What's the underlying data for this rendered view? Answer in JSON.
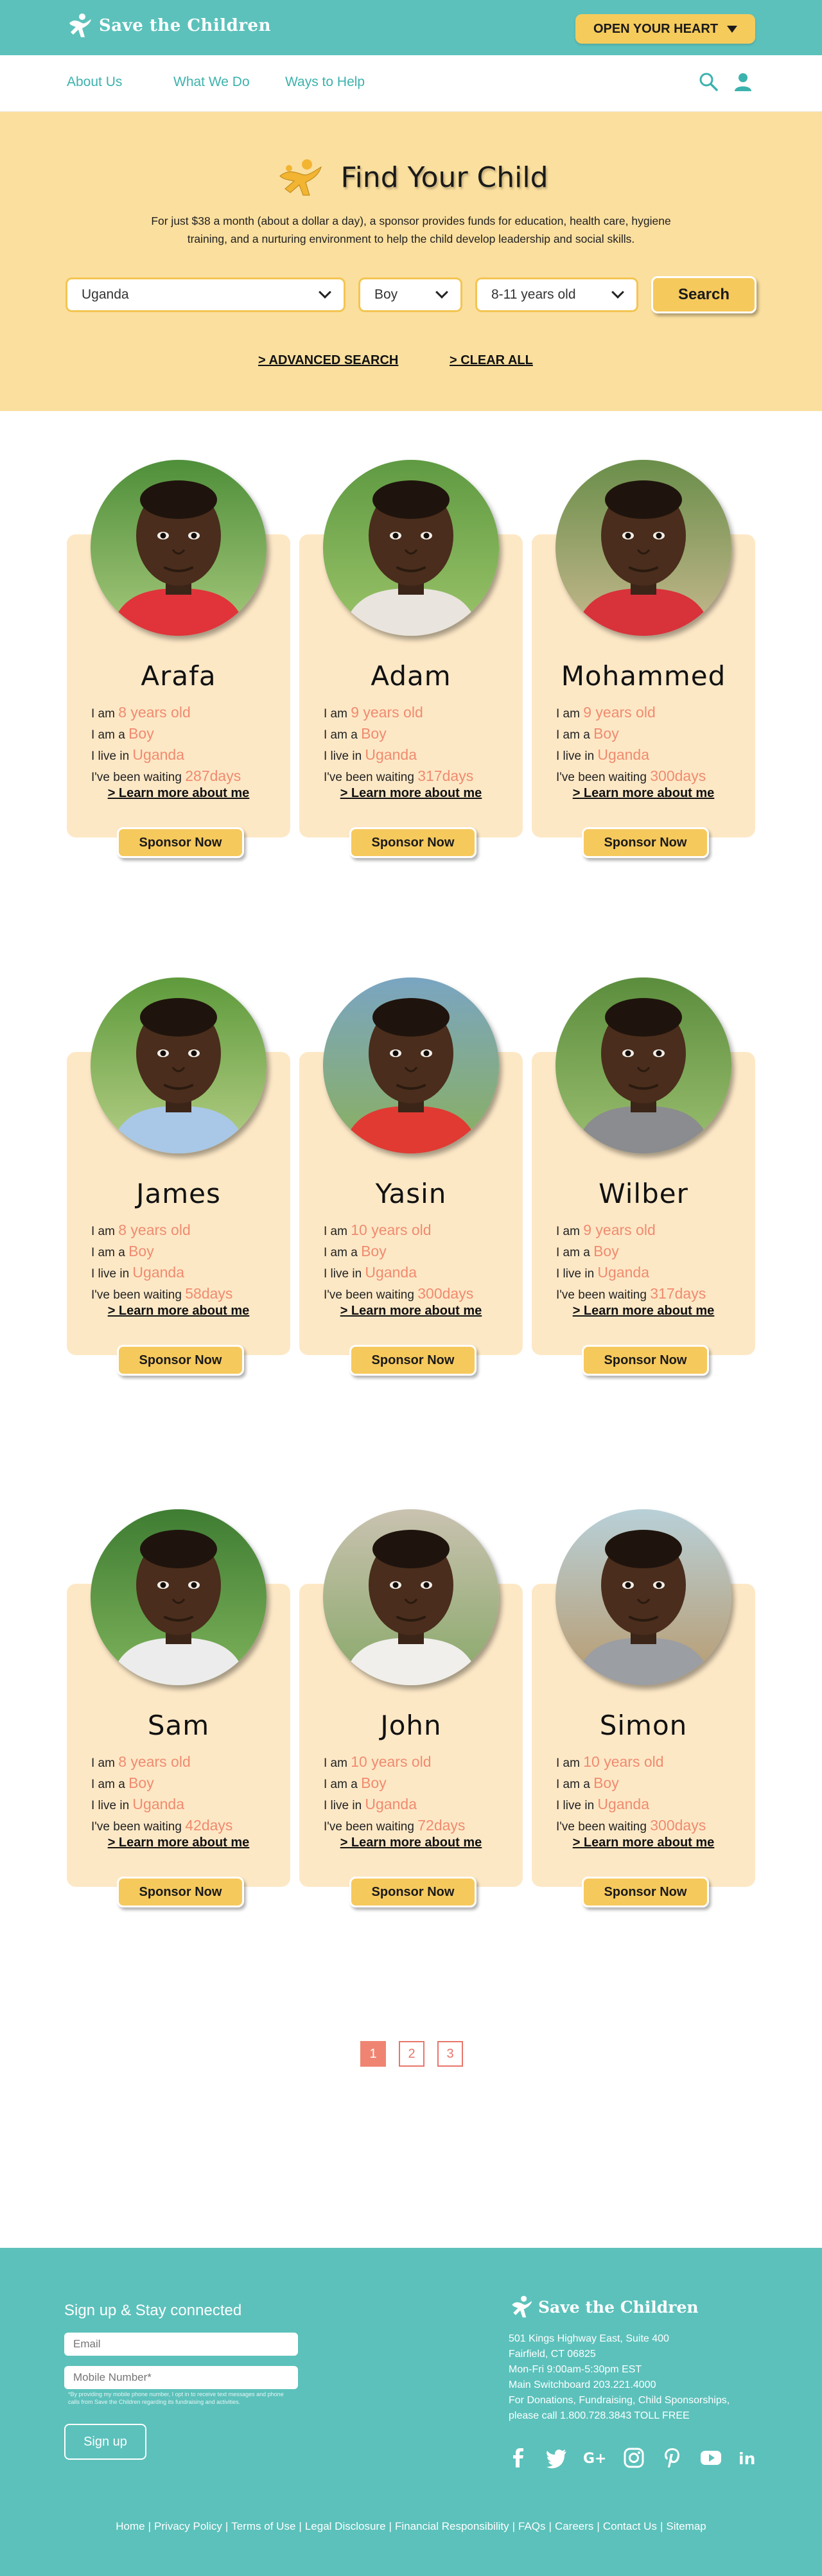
{
  "header": {
    "brand": "Save the Children",
    "cta_label": "OPEN YOUR HEART",
    "nav": [
      {
        "label": "About Us"
      },
      {
        "label": "What We Do"
      },
      {
        "label": "Ways to Help"
      }
    ],
    "icons": [
      "search-icon",
      "user-icon"
    ],
    "colors": {
      "teal": "#5cc1bb",
      "gold": "#f5cb5c",
      "hero": "#fbdf9e",
      "card": "#fde8c6",
      "coral": "#f08b6f"
    }
  },
  "hero": {
    "title": "Find Your Child",
    "description": "For just $38 a month (about a dollar a day), a sponsor provides funds for education, health care, hygiene training, and a nurturing environment to help the child develop leadership and social skills.",
    "country": "Uganda",
    "gender": "Boy",
    "age": "8-11 years old",
    "search_label": "Search",
    "advanced_label": "> ADVANCED SEARCH",
    "clear_label": "> CLEAR ALL"
  },
  "children": [
    {
      "name": "Arafa",
      "age": "8 years old",
      "gender": "Boy",
      "country": "Uganda",
      "days": "287days",
      "shirt": "#e0343a",
      "bgtop": "#4f8f3a",
      "bgbot": "#a7c97c"
    },
    {
      "name": "Adam",
      "age": "9 years old",
      "gender": "Boy",
      "country": "Uganda",
      "days": "317days",
      "shirt": "#e9e4de",
      "bgtop": "#5f9a42",
      "bgbot": "#9cc46a"
    },
    {
      "name": "Mohammed",
      "age": "9 years old",
      "gender": "Boy",
      "country": "Uganda",
      "days": "300days",
      "shirt": "#d8323b",
      "bgtop": "#6a8e4a",
      "bgbot": "#c8b98f"
    },
    {
      "name": "James",
      "age": "8 years old",
      "gender": "Boy",
      "country": "Uganda",
      "days": "58days",
      "shirt": "#a9c7e6",
      "bgtop": "#5e9a3c",
      "bgbot": "#b6cf86"
    },
    {
      "name": "Yasin",
      "age": "10 years old",
      "gender": "Boy",
      "country": "Uganda",
      "days": "300days",
      "shirt": "#e13a33",
      "bgtop": "#7aa5c2",
      "bgbot": "#8bb05c"
    },
    {
      "name": "Wilber",
      "age": "9 years old",
      "gender": "Boy",
      "country": "Uganda",
      "days": "317days",
      "shirt": "#8b8c8f",
      "bgtop": "#5b8d3d",
      "bgbot": "#9cbf70"
    },
    {
      "name": "Sam",
      "age": "8 years old",
      "gender": "Boy",
      "country": "Uganda",
      "days": "42days",
      "shirt": "#ececec",
      "bgtop": "#3f7d33",
      "bgbot": "#7fb35b"
    },
    {
      "name": "John",
      "age": "10 years old",
      "gender": "Boy",
      "country": "Uganda",
      "days": "72days",
      "shirt": "#f0efec",
      "bgtop": "#c9c2b0",
      "bgbot": "#88a868"
    },
    {
      "name": "Simon",
      "age": "10 years old",
      "gender": "Boy",
      "country": "Uganda",
      "days": "300days",
      "shirt": "#9b9ea3",
      "bgtop": "#b8d0d8",
      "bgbot": "#b89a6d"
    }
  ],
  "card_labels": {
    "i_am": "I am",
    "i_am_a": "I am a",
    "i_live_in": "I live in",
    "waiting": "I've been waiting",
    "learn": "> Learn more about me",
    "sponsor": "Sponsor Now"
  },
  "pagination": {
    "pages": [
      "1",
      "2",
      "3"
    ],
    "current": "1"
  },
  "footer": {
    "signup_title": "Sign up & Stay connected",
    "email_placeholder": "Email",
    "mobile_placeholder": "Mobile Number*",
    "fine_print": "*By providing my mobile phone number, I opt in to receive text messages and phone calls from Save the Children regarding its fundraising and activities.",
    "signup_label": "Sign up",
    "brand": "Save the Children",
    "address": [
      "501 Kings Highway East, Suite 400",
      "Fairfield, CT 06825",
      "Mon-Fri 9:00am-5:30pm EST",
      "Main Switchboard 203.221.4000",
      "For Donations, Fundraising, Child Sponsorships,",
      "please call 1.800.728.3843 TOLL FREE"
    ],
    "social": [
      "facebook-icon",
      "twitter-icon",
      "google-plus-icon",
      "instagram-icon",
      "pinterest-icon",
      "youtube-icon",
      "linkedin-icon"
    ],
    "social_glyphs": [
      "f",
      "t",
      "G+",
      "ig",
      "P",
      "yt",
      "in"
    ],
    "links": [
      "Home",
      "Privacy Policy",
      "Terms of Use",
      "Legal Disclosure",
      "Financial Responsibility",
      "FAQs",
      "Careers",
      "Contact Us",
      "Sitemap"
    ]
  }
}
